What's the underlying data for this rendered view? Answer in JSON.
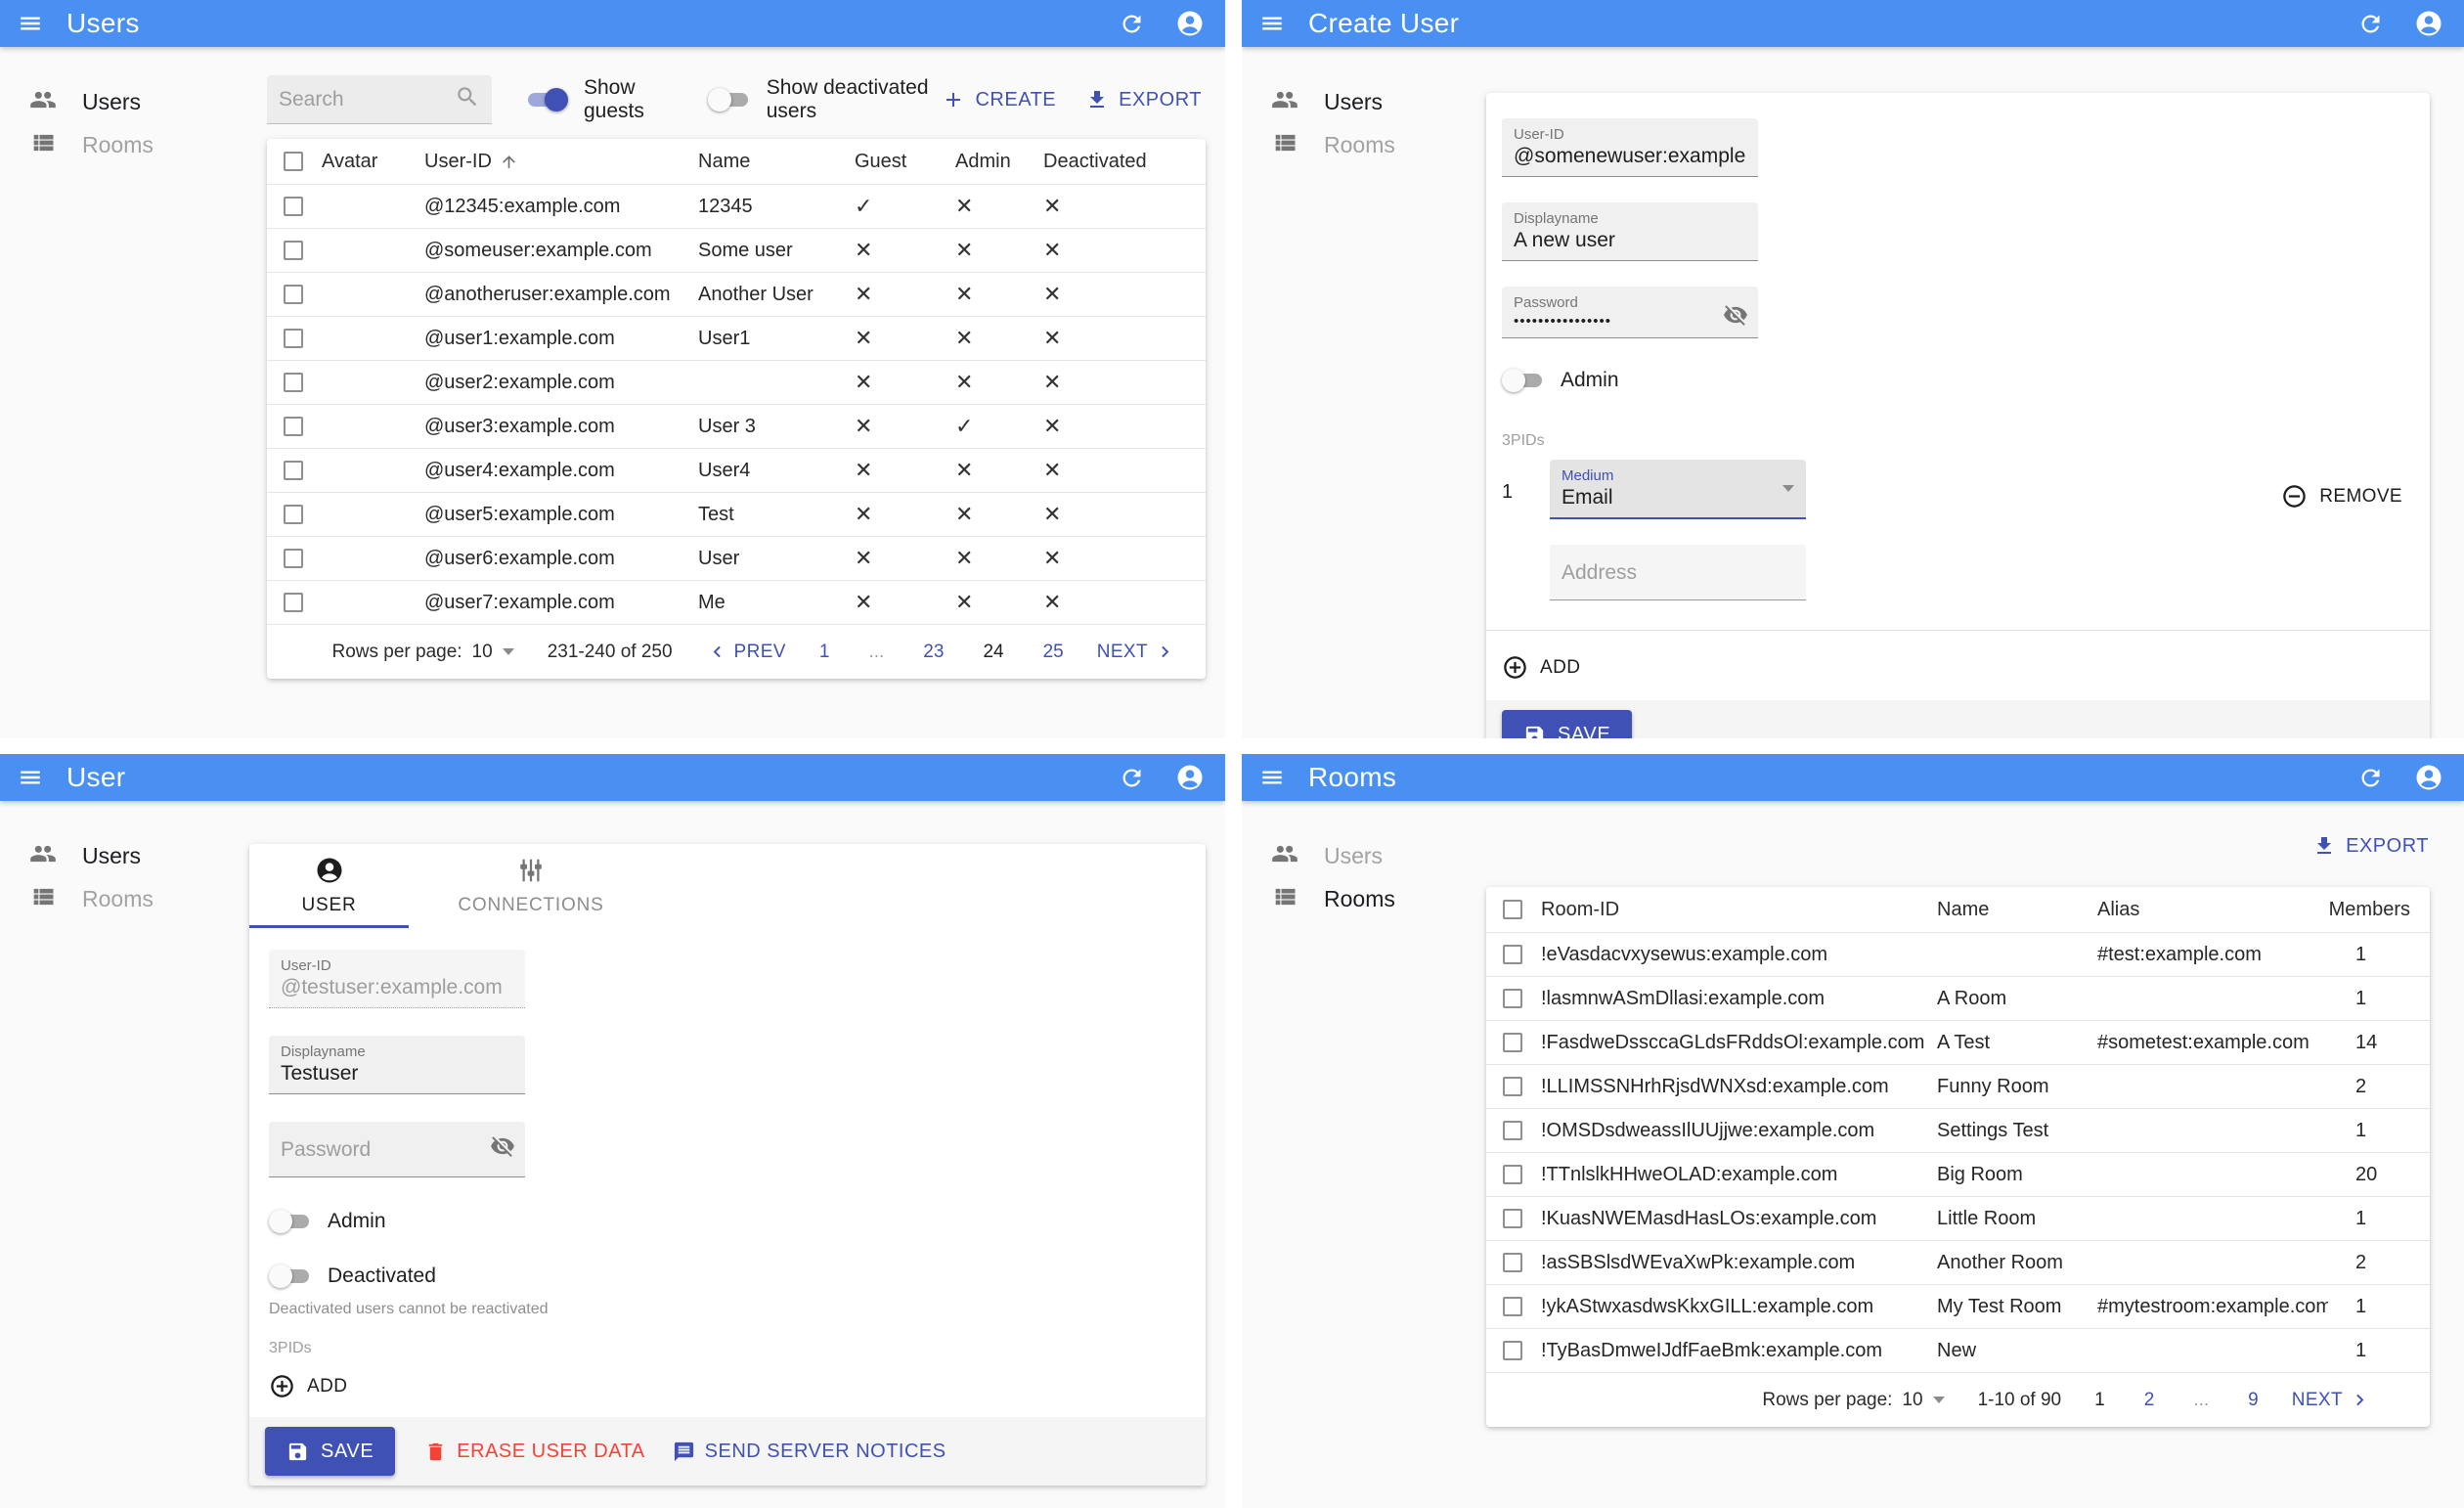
{
  "colors": {
    "appbar": "#4a90f2",
    "accent": "#3f51b5",
    "danger": "#f44336"
  },
  "sidebar": {
    "users": "Users",
    "rooms": "Rooms"
  },
  "users_list": {
    "title": "Users",
    "search_placeholder": "Search",
    "show_guests_label": "Show guests",
    "show_deactivated_label": "Show deactivated users",
    "create_label": "CREATE",
    "export_label": "EXPORT",
    "table": {
      "headers": {
        "avatar": "Avatar",
        "user_id": "User-ID",
        "name": "Name",
        "guest": "Guest",
        "admin": "Admin",
        "deactivated": "Deactivated"
      },
      "rows": [
        {
          "user_id": "@12345:example.com",
          "name": "12345",
          "guest": true,
          "admin": false,
          "deactivated": false
        },
        {
          "user_id": "@someuser:example.com",
          "name": "Some user",
          "guest": false,
          "admin": false,
          "deactivated": false
        },
        {
          "user_id": "@anotheruser:example.com",
          "name": "Another User",
          "guest": false,
          "admin": false,
          "deactivated": false
        },
        {
          "user_id": "@user1:example.com",
          "name": "User1",
          "guest": false,
          "admin": false,
          "deactivated": false
        },
        {
          "user_id": "@user2:example.com",
          "name": "",
          "guest": false,
          "admin": false,
          "deactivated": false
        },
        {
          "user_id": "@user3:example.com",
          "name": "User 3",
          "guest": false,
          "admin": true,
          "deactivated": false
        },
        {
          "user_id": "@user4:example.com",
          "name": "User4",
          "guest": false,
          "admin": false,
          "deactivated": false
        },
        {
          "user_id": "@user5:example.com",
          "name": "Test",
          "guest": false,
          "admin": false,
          "deactivated": false
        },
        {
          "user_id": "@user6:example.com",
          "name": "User",
          "guest": false,
          "admin": false,
          "deactivated": false
        },
        {
          "user_id": "@user7:example.com",
          "name": "Me",
          "guest": false,
          "admin": false,
          "deactivated": false
        }
      ]
    },
    "pagination": {
      "rows_per_page_label": "Rows per page:",
      "rows_per_page": "10",
      "range": "231-240 of 250",
      "prev": "PREV",
      "next": "NEXT",
      "pages": [
        {
          "label": "1",
          "state": "link"
        },
        {
          "label": "...",
          "state": "gap"
        },
        {
          "label": "23",
          "state": "link"
        },
        {
          "label": "24",
          "state": "current"
        },
        {
          "label": "25",
          "state": "link"
        }
      ]
    }
  },
  "create_user": {
    "title": "Create User",
    "user_id": {
      "label": "User-ID",
      "value": "@somenewuser:example.com"
    },
    "displayname": {
      "label": "Displayname",
      "value": "A new user"
    },
    "password": {
      "label": "Password",
      "value": "••••••••••••••••"
    },
    "admin_label": "Admin",
    "threepids_label": "3PIDs",
    "threepid_index": "1",
    "medium": {
      "label": "Medium",
      "value": "Email"
    },
    "remove_label": "REMOVE",
    "address_placeholder": "Address",
    "add_label": "ADD",
    "save_label": "SAVE"
  },
  "user_edit": {
    "title": "User",
    "tabs": {
      "user": "USER",
      "connections": "CONNECTIONS"
    },
    "user_id": {
      "label": "User-ID",
      "value": "@testuser:example.com"
    },
    "displayname": {
      "label": "Displayname",
      "value": "Testuser"
    },
    "password_placeholder": "Password",
    "admin_label": "Admin",
    "deactivated_label": "Deactivated",
    "deactivated_helper": "Deactivated users cannot be reactivated",
    "threepids_label": "3PIDs",
    "add_label": "ADD",
    "save_label": "SAVE",
    "erase_label": "ERASE USER DATA",
    "notices_label": "SEND SERVER NOTICES"
  },
  "rooms_list": {
    "title": "Rooms",
    "export_label": "EXPORT",
    "table": {
      "headers": {
        "room_id": "Room-ID",
        "name": "Name",
        "alias": "Alias",
        "members": "Members"
      },
      "rows": [
        {
          "room_id": "!eVasdacvxysewus:example.com",
          "name": "",
          "alias": "#test:example.com",
          "members": "1"
        },
        {
          "room_id": "!lasmnwASmDllasi:example.com",
          "name": "A Room",
          "alias": "",
          "members": "1"
        },
        {
          "room_id": "!FasdweDssccaGLdsFRddsOl:example.com",
          "name": "A Test",
          "alias": "#sometest:example.com",
          "members": "14"
        },
        {
          "room_id": "!LLIMSSNHrhRjsdWNXsd:example.com",
          "name": "Funny Room",
          "alias": "",
          "members": "2"
        },
        {
          "room_id": "!OMSDsdweassIlUUjjwe:example.com",
          "name": "Settings Test",
          "alias": "",
          "members": "1"
        },
        {
          "room_id": "!TTnlslkHHweOLAD:example.com",
          "name": "Big Room",
          "alias": "",
          "members": "20"
        },
        {
          "room_id": "!KuasNWEMasdHasLOs:example.com",
          "name": "Little Room",
          "alias": "",
          "members": "1"
        },
        {
          "room_id": "!asSBSlsdWEvaXwPk:example.com",
          "name": "Another Room",
          "alias": "",
          "members": "2"
        },
        {
          "room_id": "!ykAStwxasdwsKkxGILL:example.com",
          "name": "My Test Room",
          "alias": "#mytestroom:example.com",
          "members": "1"
        },
        {
          "room_id": "!TyBasDmweIJdfFaeBmk:example.com",
          "name": "New",
          "alias": "",
          "members": "1"
        }
      ]
    },
    "pagination": {
      "rows_per_page_label": "Rows per page:",
      "rows_per_page": "10",
      "range": "1-10 of 90",
      "next": "NEXT",
      "pages": [
        {
          "label": "1",
          "state": "current"
        },
        {
          "label": "2",
          "state": "link"
        },
        {
          "label": "...",
          "state": "gap"
        },
        {
          "label": "9",
          "state": "link"
        }
      ]
    }
  }
}
